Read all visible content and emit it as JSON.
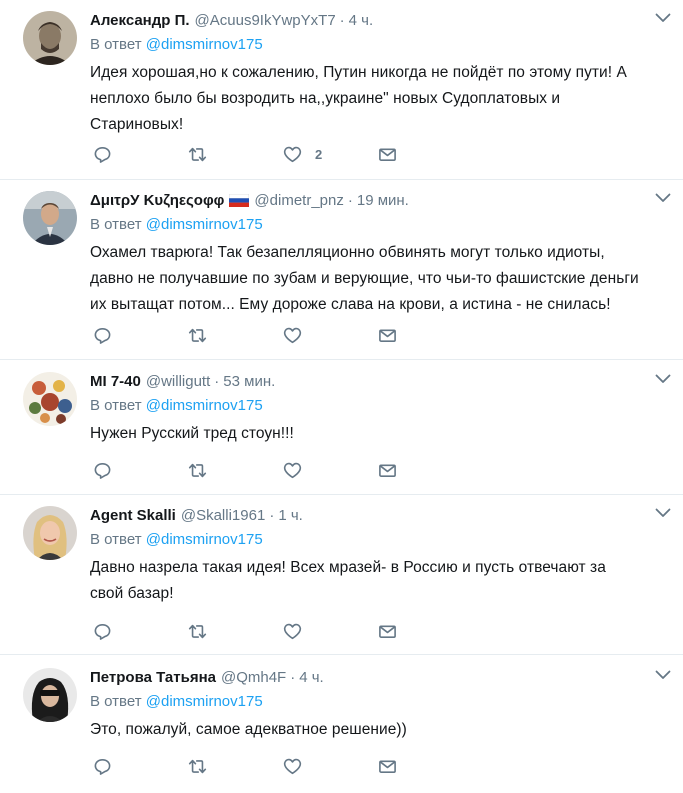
{
  "tweets": [
    {
      "name": "Александр П.",
      "handle": "@Acuus9IkYwpYxT7",
      "separator": "·",
      "time": "4 ч.",
      "reply_prefix": "В ответ",
      "reply_mention": "@dimsmirnov175",
      "text": "Идея хорошая,но к сожалению, Путин никогда не пойдёт по этому пути! А неплохо было бы возродить на,,украине\" новых Судоплатовых и Стариновых!",
      "like_count": "2",
      "has_flag": false
    },
    {
      "name": "ΔμιτρУ Kυζηεςοφφ",
      "handle": "@dimetr_pnz",
      "separator": "·",
      "time": "19 мин.",
      "reply_prefix": "В ответ",
      "reply_mention": "@dimsmirnov175",
      "text": "Охамел тварюга! Так безапелляционно обвинять могут только идиоты, давно не получавшие по зубам и верующие, что чьи-то фашистские деньги их вытащат потом... Ему дороже слава на крови, а истина - не снилась!",
      "like_count": "",
      "has_flag": true
    },
    {
      "name": "MI 7-40",
      "handle": "@willigutt",
      "separator": "·",
      "time": "53 мин.",
      "reply_prefix": "В ответ",
      "reply_mention": "@dimsmirnov175",
      "text": "Нужен Русский тред стоун!!!",
      "like_count": "",
      "has_flag": false
    },
    {
      "name": "Agent Skalli",
      "handle": "@Skalli1961",
      "separator": "·",
      "time": "1 ч.",
      "reply_prefix": "В ответ",
      "reply_mention": "@dimsmirnov175",
      "text": "Давно назрела такая идея! Всех мразей- в Россию и пусть отвечают за свой базар!",
      "like_count": "",
      "has_flag": false
    },
    {
      "name": "Петрова Татьяна",
      "handle": "@Qmh4F",
      "separator": "·",
      "time": "4 ч.",
      "reply_prefix": "В ответ",
      "reply_mention": "@dimsmirnov175",
      "text": "Это, пожалуй, самое адекватное решение))",
      "like_count": "",
      "has_flag": false
    }
  ],
  "icons": {
    "reply": "reply-icon",
    "retweet": "retweet-icon",
    "like": "like-icon",
    "message": "message-icon",
    "more": "chevron-down-icon",
    "flag": "russia-flag-icon"
  },
  "colors": {
    "link": "#1da1f2",
    "secondary_text": "#657786",
    "icon": "#657786",
    "divider": "#e6ecf0"
  }
}
